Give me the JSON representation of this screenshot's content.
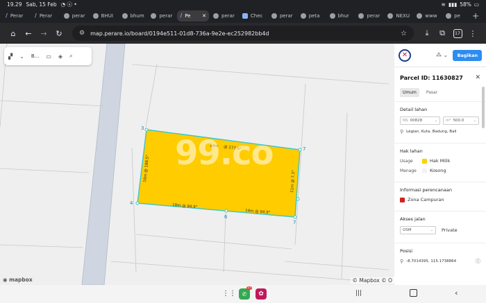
{
  "status": {
    "time": "19.29",
    "date": "Sab, 15 Feb",
    "battery": "58%"
  },
  "tabs": [
    {
      "label": "Perar",
      "icon": "slash-icon"
    },
    {
      "label": "Perar",
      "icon": "slash-icon"
    },
    {
      "label": "perar",
      "icon": "globe-icon"
    },
    {
      "label": "BHUI",
      "icon": "globe-icon"
    },
    {
      "label": "bhum",
      "icon": "globe-icon"
    },
    {
      "label": "perar",
      "icon": "globe-icon"
    },
    {
      "label": "Pe",
      "icon": "slash-icon",
      "active": true
    },
    {
      "label": "perar",
      "icon": "globe-icon"
    },
    {
      "label": "Chec",
      "icon": "check-icon"
    },
    {
      "label": "perar",
      "icon": "globe-icon"
    },
    {
      "label": "peta",
      "icon": "globe-icon"
    },
    {
      "label": "bhur",
      "icon": "globe-icon"
    },
    {
      "label": "perar",
      "icon": "globe-icon"
    },
    {
      "label": "NEXU",
      "icon": "globe-icon"
    },
    {
      "label": "www",
      "icon": "globe-icon"
    },
    {
      "label": "pe",
      "icon": "globe-icon"
    }
  ],
  "browser": {
    "url": "map.perare.io/board/0194e511-01d8-736a-9e2e-ec252982bb4d",
    "tab_count": "17"
  },
  "map": {
    "toolbar_label": "B...",
    "watermark": "99.co",
    "logo": "mapbox",
    "attribution": "© Mapbox © O",
    "vertices": [
      "3",
      "7",
      "4",
      "6",
      "7"
    ],
    "edge_labels": {
      "top_a": "14m",
      "top_b": "@ 277.6°",
      "left": "16m @ 188.5°",
      "right": "11m @ 7.3°",
      "bottom_a": "18m @ 94.9°",
      "bottom_b": "14m @ 94.9°"
    },
    "colors": {
      "parcel_fill": "#ffcc00",
      "parcel_stroke": "#37c7c7"
    }
  },
  "panel": {
    "share_button": "Bagikan",
    "title": "Parcel ID: 11630827",
    "tabs": [
      "Umum",
      "Pasar"
    ],
    "detail": {
      "title": "Detail lahan",
      "field1_prefix": "NS",
      "field1_value": "00828",
      "field2_prefix": "m²",
      "field2_value": "500.0",
      "location": "Legian, Kuta, Badung, Bali"
    },
    "rights": {
      "title": "Hak lahan",
      "usage_label": "Usage",
      "usage_value": "Hak Milik",
      "manage_label": "Manage",
      "manage_value": "Kosong",
      "usage_color": "#ffd000"
    },
    "planning": {
      "title": "Informasi perencanaan",
      "zone": "Zona Campuran",
      "zone_color": "#d32020"
    },
    "access": {
      "title": "Akses jalan",
      "road_type": "OSM",
      "road_status": "Private"
    },
    "position": {
      "title": "Posisi",
      "coords": "-8.7014395, 115.1738864"
    }
  },
  "bottom": {
    "badge": "57"
  }
}
